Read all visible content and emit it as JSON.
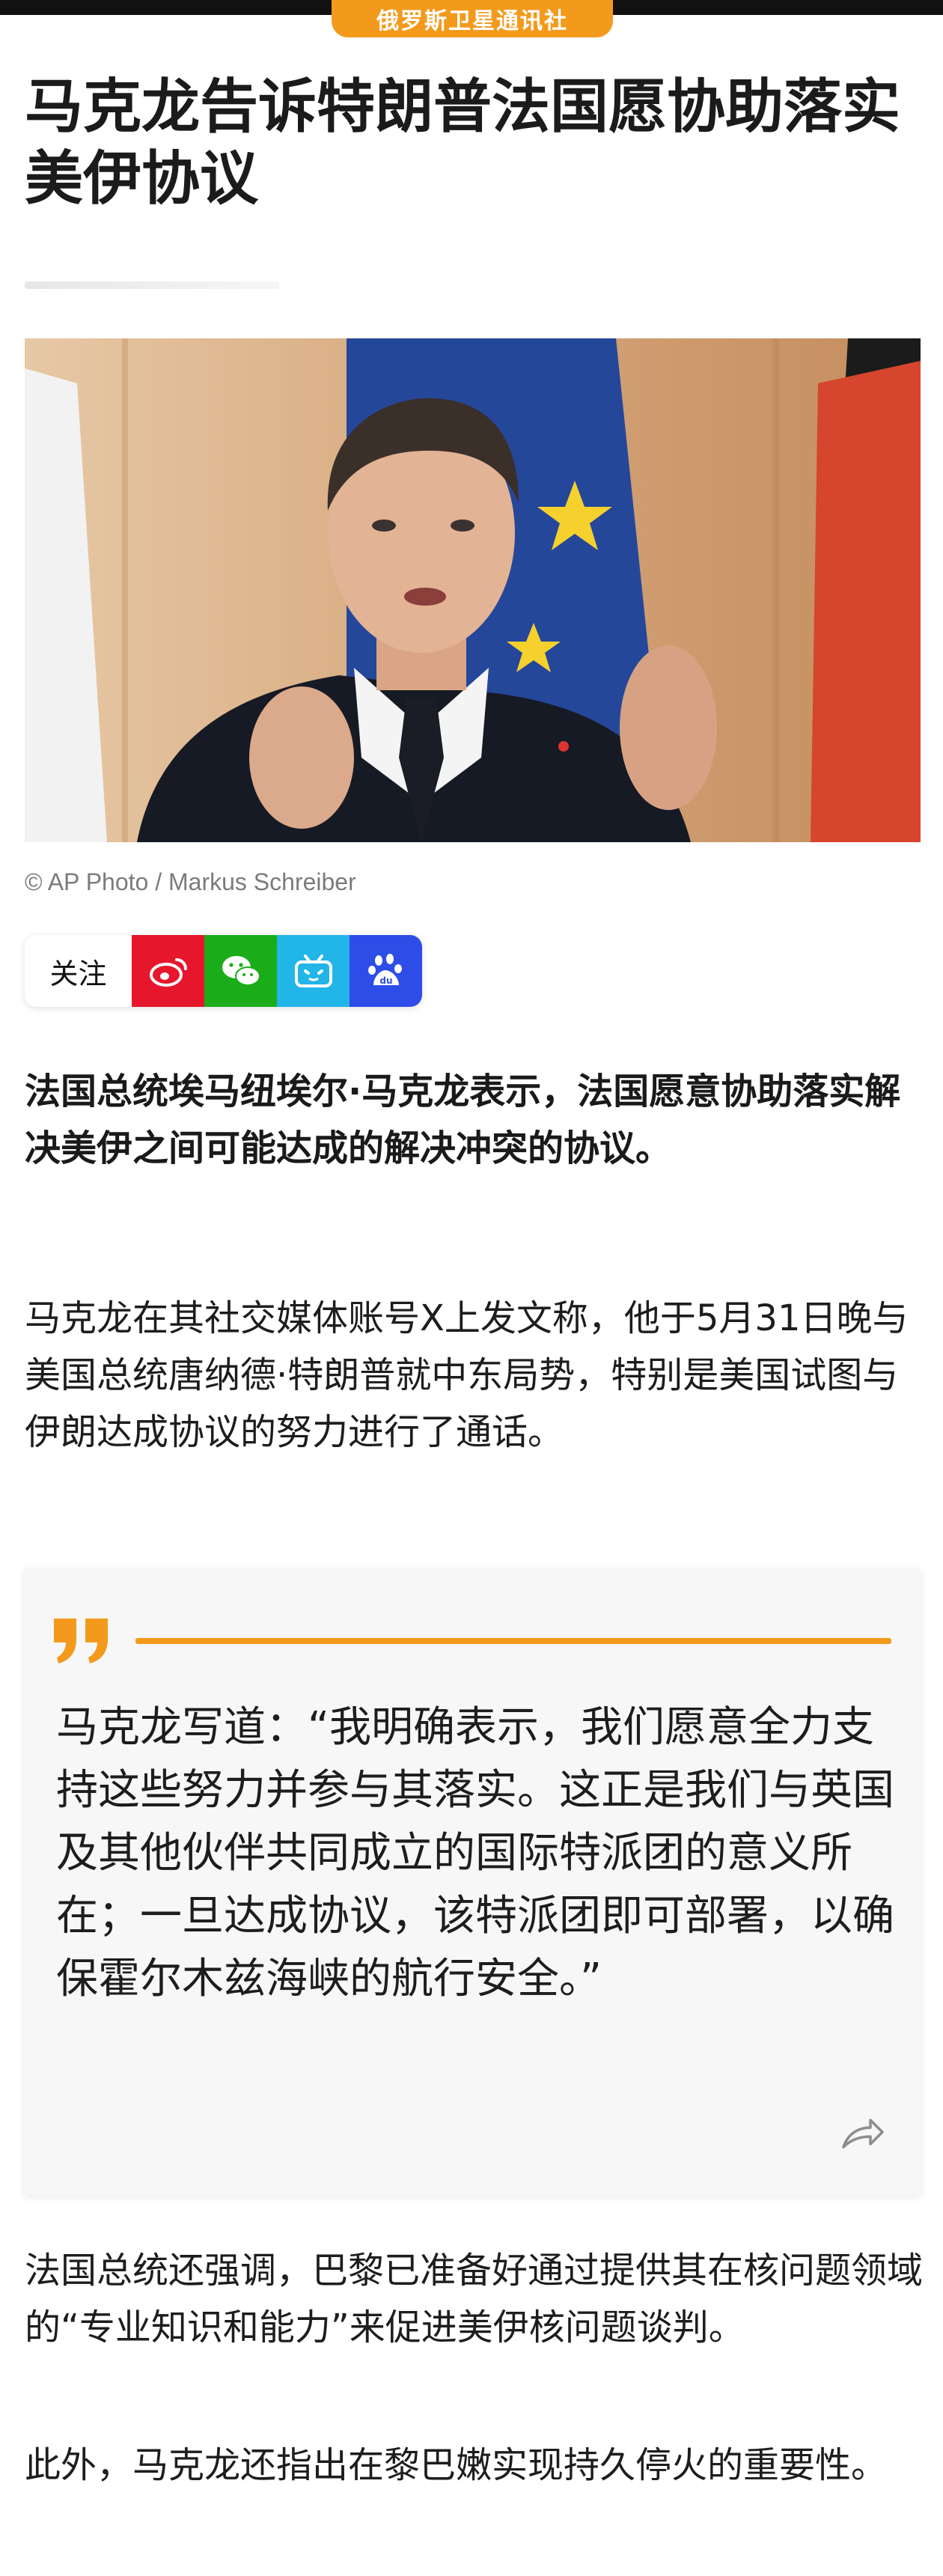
{
  "source": "俄罗斯卫星通讯社",
  "headline": "马克龙告诉特朗普法国愿协助落实美伊协议",
  "photo_credit": "© AP Photo / Markus Schreiber",
  "share": {
    "follow_label": "关注",
    "services": [
      "weibo-icon",
      "wechat-icon",
      "bilibili-icon",
      "baidu-icon"
    ]
  },
  "lead": "法国总统埃马纽埃尔·马克龙表示，法国愿意协助落实解决美伊之间可能达成的解决冲突的协议。",
  "paragraph1": "马克龙在其社交媒体账号X上发文称，他于5月31日晚与美国总统唐纳德·特朗普就中东局势，特别是美国试图与伊朗达成协议的努力进行了通话。",
  "quote": "马克龙写道：“我明确表示，我们愿意全力支持这些努力并参与其落实。这正是我们与英国及其他伙伴共同成立的国际特派团的意义所在；一旦达成协议，该特派团即可部署，以确保霍尔木兹海峡的航行安全。”",
  "paragraph2": "法国总统还强调，巴黎已准备好通过提供其在核问题领域的“专业知识和能力”来促进美伊核问题谈判。",
  "paragraph3": "此外，马克龙还指出在黎巴嫩实现持久停火的重要性。",
  "colors": {
    "accent": "#f39a1c",
    "weibo": "#e6162d",
    "wechat": "#1aad19",
    "bilibili": "#21b5e8",
    "baidu": "#2d4ce8"
  }
}
